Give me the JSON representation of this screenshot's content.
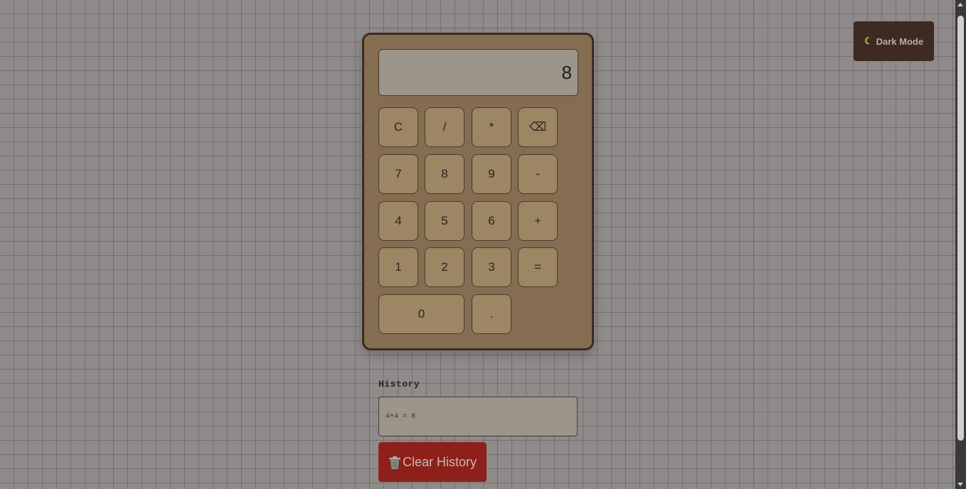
{
  "theme_toggle": {
    "icon": "moon-icon",
    "label": "Dark Mode"
  },
  "calculator": {
    "display": "8",
    "keys": {
      "clear": "C",
      "divide": "/",
      "multiply": "*",
      "backspace": "⌫",
      "seven": "7",
      "eight": "8",
      "nine": "9",
      "minus": "-",
      "four": "4",
      "five": "5",
      "six": "6",
      "plus": "+",
      "one": "1",
      "two": "2",
      "three": "3",
      "equals": "=",
      "zero": "0",
      "decimal": "."
    }
  },
  "history": {
    "title": "History",
    "entries": [
      "4+4 = 8"
    ]
  },
  "clear_history": {
    "icon": "trash-icon",
    "label": "Clear History"
  },
  "colors": {
    "page_background": "#8f8b8b",
    "calculator_body": "#846d51",
    "key": "#9d8663",
    "display": "#9b958a",
    "theme_toggle": "#3d2b21",
    "clear_history": "#8d211a"
  }
}
